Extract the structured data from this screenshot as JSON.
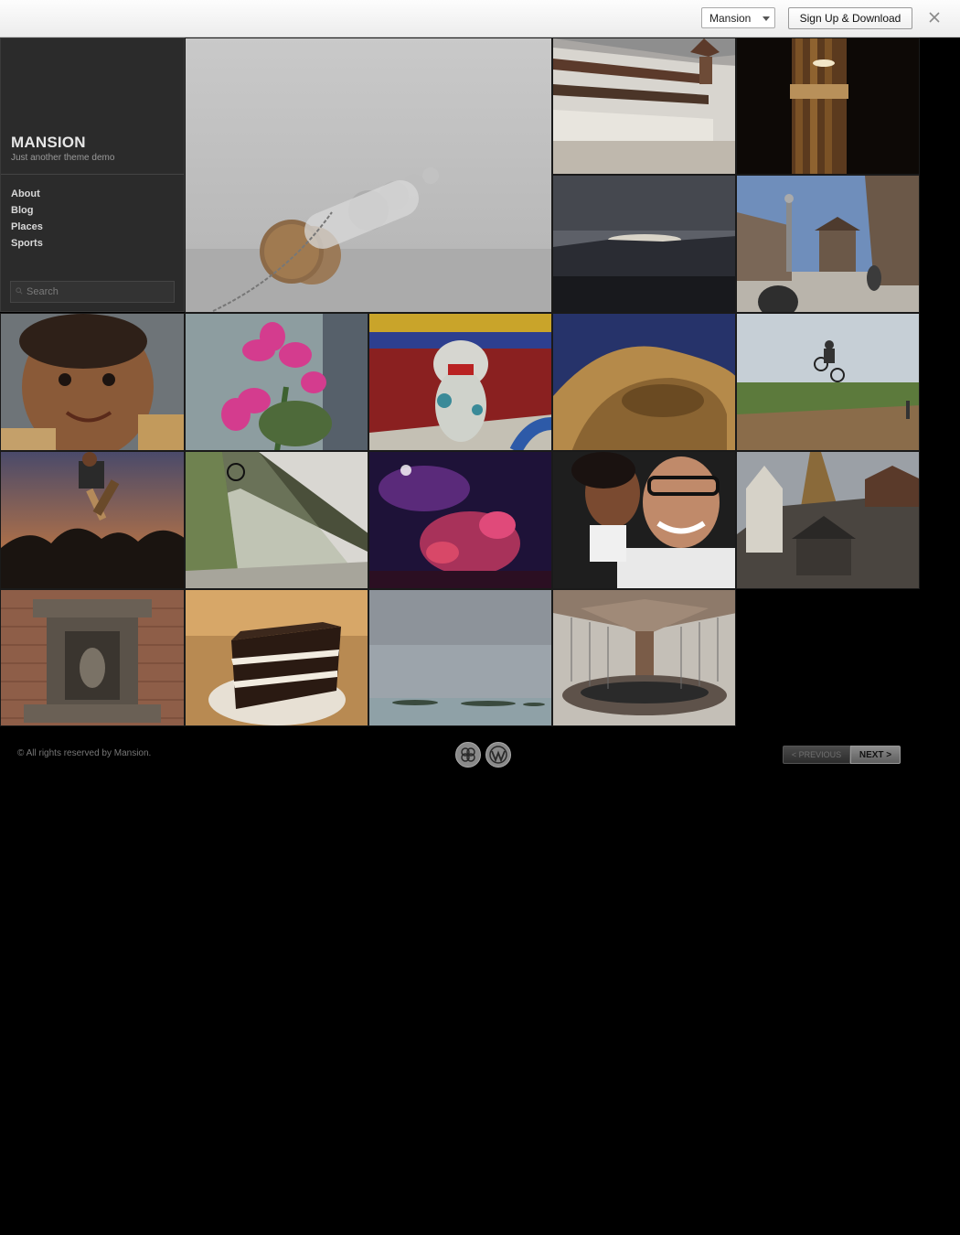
{
  "demo_bar": {
    "theme_select_value": "Mansion",
    "signup_label": "Sign Up & Download",
    "close_icon": "close-icon"
  },
  "site": {
    "title": "MANSION",
    "tagline": "Just another theme demo"
  },
  "nav": {
    "items": [
      "About",
      "Blog",
      "Places",
      "Sports"
    ]
  },
  "search": {
    "placeholder": "Search"
  },
  "gallery": {
    "tiles": [
      {
        "subject": "buoy-in-fog"
      },
      {
        "subject": "palace-courtyard"
      },
      {
        "subject": "wooden-pillar-lantern"
      },
      {
        "subject": "sunset-clouds"
      },
      {
        "subject": "durbar-square"
      },
      {
        "subject": "smiling-child"
      },
      {
        "subject": "pink-flowers"
      },
      {
        "subject": "temple-lion-statue"
      },
      {
        "subject": "wooden-sculpture"
      },
      {
        "subject": "bmx-jump"
      },
      {
        "subject": "skateboarder-sunset"
      },
      {
        "subject": "bmx-under-bridge"
      },
      {
        "subject": "drummer-lights"
      },
      {
        "subject": "couple-selfie"
      },
      {
        "subject": "stupa-temple"
      },
      {
        "subject": "carved-shrine"
      },
      {
        "subject": "chocolate-cake"
      },
      {
        "subject": "lake-islands"
      },
      {
        "subject": "carousel"
      }
    ]
  },
  "footer": {
    "copyright": "© All rights reserved by Mansion.",
    "logos": [
      "theme-logo-icon",
      "wordpress-icon"
    ],
    "previous_label": "< PREVIOUS",
    "next_label": "NEXT >"
  }
}
